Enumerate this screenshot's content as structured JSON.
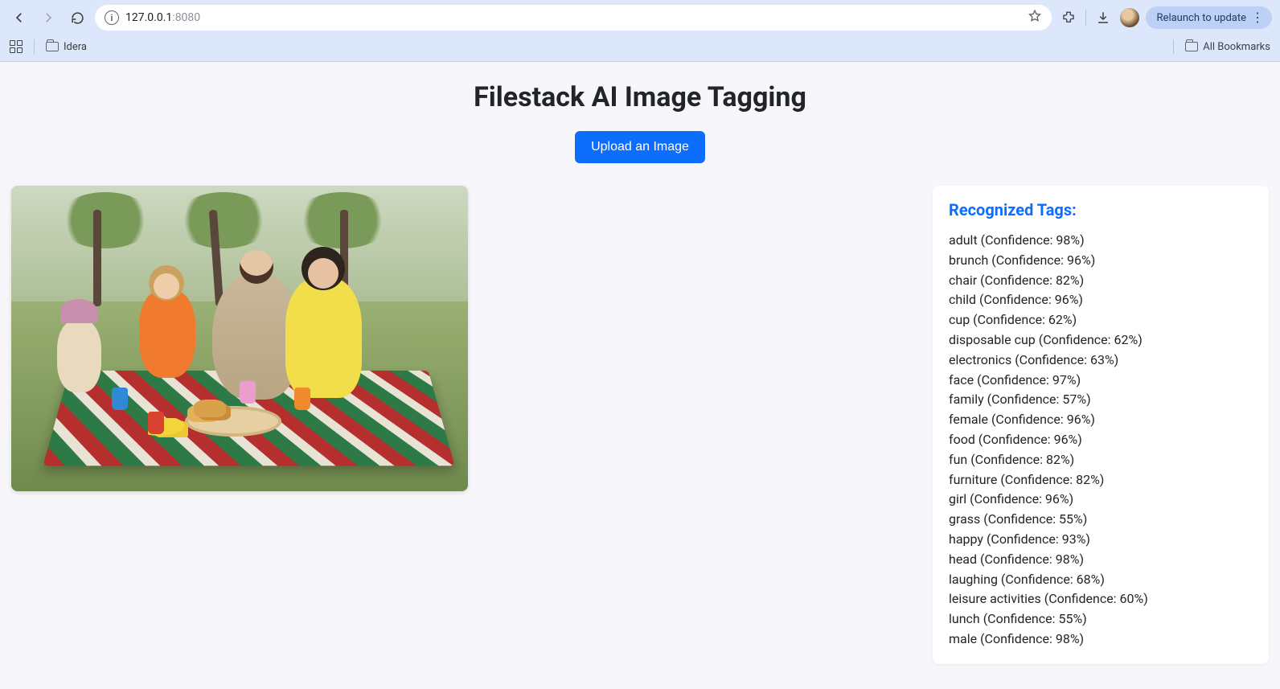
{
  "browser": {
    "url_host": "127.0.0.1",
    "url_port": ":8080",
    "relaunch_label": "Relaunch to update",
    "bookmarks": {
      "folder1": "Idera",
      "all": "All Bookmarks"
    }
  },
  "page": {
    "title": "Filestack AI Image Tagging",
    "upload_label": "Upload an Image",
    "tags_heading": "Recognized Tags:",
    "tags": [
      {
        "name": "adult",
        "confidence": 98
      },
      {
        "name": "brunch",
        "confidence": 96
      },
      {
        "name": "chair",
        "confidence": 82
      },
      {
        "name": "child",
        "confidence": 96
      },
      {
        "name": "cup",
        "confidence": 62
      },
      {
        "name": "disposable cup",
        "confidence": 62
      },
      {
        "name": "electronics",
        "confidence": 63
      },
      {
        "name": "face",
        "confidence": 97
      },
      {
        "name": "family",
        "confidence": 57
      },
      {
        "name": "female",
        "confidence": 96
      },
      {
        "name": "food",
        "confidence": 96
      },
      {
        "name": "fun",
        "confidence": 82
      },
      {
        "name": "furniture",
        "confidence": 82
      },
      {
        "name": "girl",
        "confidence": 96
      },
      {
        "name": "grass",
        "confidence": 55
      },
      {
        "name": "happy",
        "confidence": 93
      },
      {
        "name": "head",
        "confidence": 98
      },
      {
        "name": "laughing",
        "confidence": 68
      },
      {
        "name": "leisure activities",
        "confidence": 60
      },
      {
        "name": "lunch",
        "confidence": 55
      },
      {
        "name": "male",
        "confidence": 98
      }
    ]
  }
}
